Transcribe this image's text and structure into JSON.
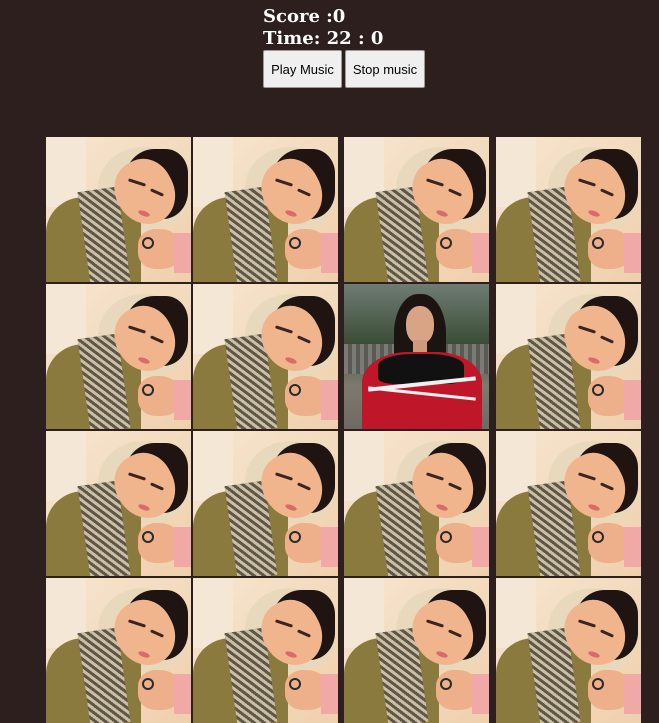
{
  "hud": {
    "score_text": "Score :0",
    "time_text": "Time: 22 : 0"
  },
  "controls": {
    "play_label": "Play Music",
    "stop_label": "Stop music"
  },
  "board": {
    "rows": 4,
    "cols": 4,
    "revealed_tiles": [
      6
    ]
  }
}
